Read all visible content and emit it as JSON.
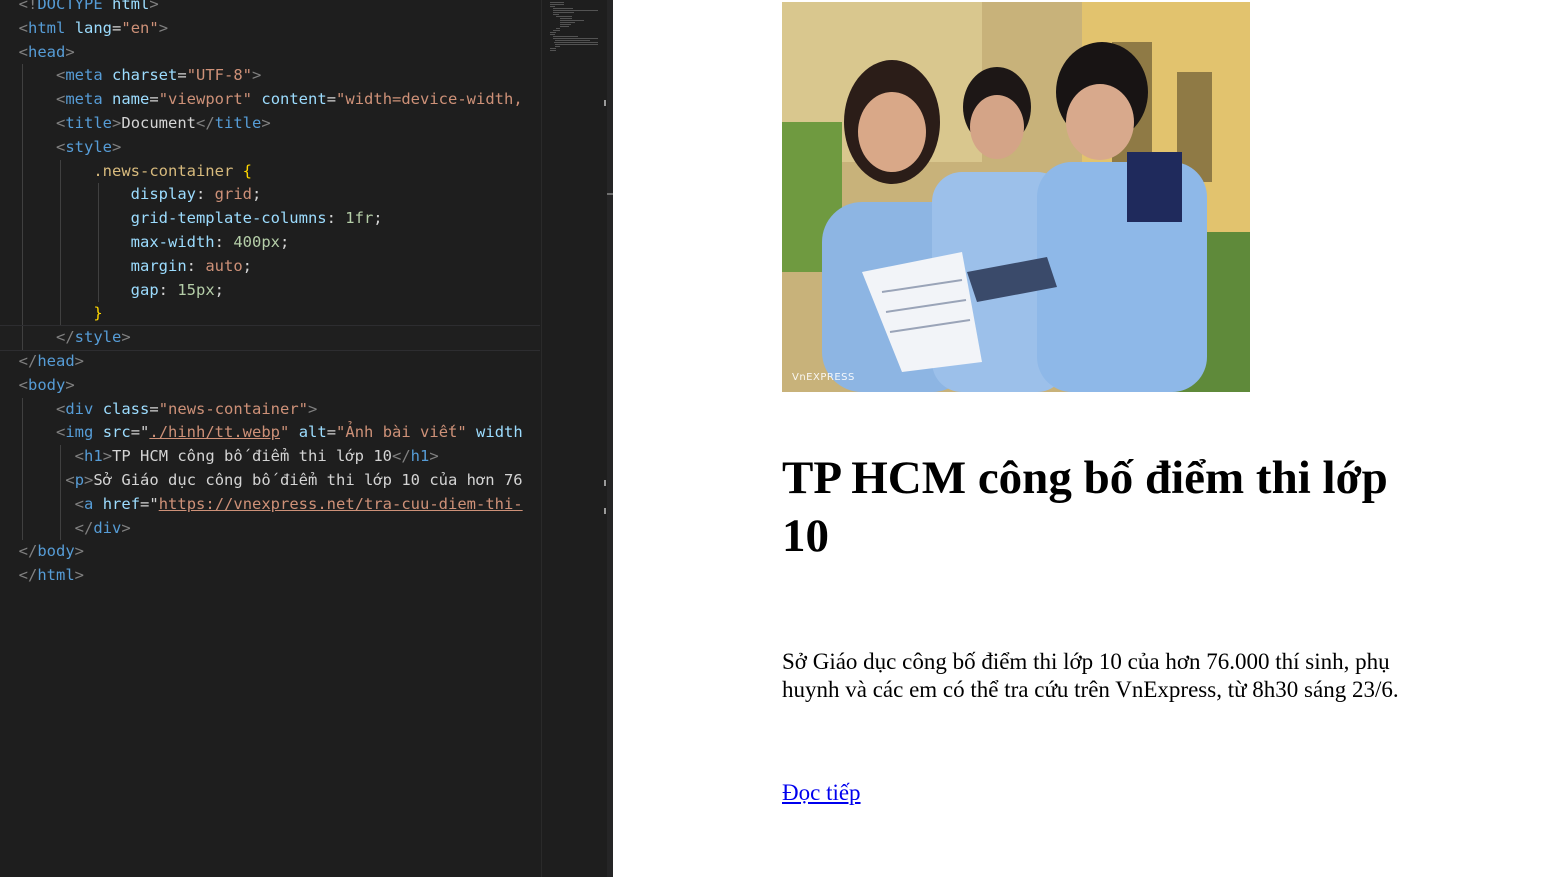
{
  "editor": {
    "code_lines": [
      [
        [
          "t",
          "<!"
        ],
        [
          "tn",
          "DOCTYPE"
        ],
        [
          "tx",
          " "
        ],
        [
          "an",
          "html"
        ],
        [
          "t",
          ">"
        ]
      ],
      [
        [
          "t",
          "<"
        ],
        [
          "tn",
          "html"
        ],
        [
          "tx",
          " "
        ],
        [
          "an",
          "lang"
        ],
        [
          "tx",
          "="
        ],
        [
          "av",
          "\"en\""
        ],
        [
          "t",
          ">"
        ]
      ],
      [
        [
          "t",
          "<"
        ],
        [
          "tn",
          "head"
        ],
        [
          "t",
          ">"
        ]
      ],
      [
        [
          "tx",
          "    "
        ],
        [
          "t",
          "<"
        ],
        [
          "tn",
          "meta"
        ],
        [
          "tx",
          " "
        ],
        [
          "an",
          "charset"
        ],
        [
          "tx",
          "="
        ],
        [
          "av",
          "\"UTF-8\""
        ],
        [
          "t",
          ">"
        ]
      ],
      [
        [
          "tx",
          "    "
        ],
        [
          "t",
          "<"
        ],
        [
          "tn",
          "meta"
        ],
        [
          "tx",
          " "
        ],
        [
          "an",
          "name"
        ],
        [
          "tx",
          "="
        ],
        [
          "av",
          "\"viewport\""
        ],
        [
          "tx",
          " "
        ],
        [
          "an",
          "content"
        ],
        [
          "tx",
          "="
        ],
        [
          "av",
          "\"width=device-width,"
        ]
      ],
      [
        [
          "tx",
          "    "
        ],
        [
          "t",
          "<"
        ],
        [
          "tn",
          "title"
        ],
        [
          "t",
          ">"
        ],
        [
          "tx",
          "Document"
        ],
        [
          "t",
          "</"
        ],
        [
          "tn",
          "title"
        ],
        [
          "t",
          ">"
        ]
      ],
      [
        [
          "tx",
          "    "
        ],
        [
          "t",
          "<"
        ],
        [
          "tn",
          "style"
        ],
        [
          "t",
          ">"
        ]
      ],
      [
        [
          "tx",
          "        "
        ],
        [
          "sel",
          ".news-container"
        ],
        [
          "tx",
          " "
        ],
        [
          "br",
          "{"
        ]
      ],
      [
        [
          "tx",
          "            "
        ],
        [
          "an",
          "display"
        ],
        [
          "tx",
          ": "
        ],
        [
          "av",
          "grid"
        ],
        [
          "tx",
          ";"
        ]
      ],
      [
        [
          "tx",
          "            "
        ],
        [
          "an",
          "grid-template-columns"
        ],
        [
          "tx",
          ": "
        ],
        [
          "nm",
          "1fr"
        ],
        [
          "tx",
          ";"
        ]
      ],
      [
        [
          "tx",
          "            "
        ],
        [
          "an",
          "max-width"
        ],
        [
          "tx",
          ": "
        ],
        [
          "nm",
          "400px"
        ],
        [
          "tx",
          ";"
        ]
      ],
      [
        [
          "tx",
          "            "
        ],
        [
          "an",
          "margin"
        ],
        [
          "tx",
          ": "
        ],
        [
          "av",
          "auto"
        ],
        [
          "tx",
          ";"
        ]
      ],
      [
        [
          "tx",
          "            "
        ],
        [
          "an",
          "gap"
        ],
        [
          "tx",
          ": "
        ],
        [
          "nm",
          "15px"
        ],
        [
          "tx",
          ";"
        ]
      ],
      [
        [
          "tx",
          "        "
        ],
        [
          "br",
          "}"
        ]
      ],
      [
        [
          "tx",
          "    "
        ],
        [
          "t",
          "</"
        ],
        [
          "tn",
          "style"
        ],
        [
          "t",
          ">"
        ]
      ],
      [
        [
          "t",
          "</"
        ],
        [
          "tn",
          "head"
        ],
        [
          "t",
          ">"
        ]
      ],
      [
        [
          "t",
          "<"
        ],
        [
          "tn",
          "body"
        ],
        [
          "t",
          ">"
        ]
      ],
      [
        [
          "tx",
          "    "
        ],
        [
          "t",
          "<"
        ],
        [
          "tn",
          "div"
        ],
        [
          "tx",
          " "
        ],
        [
          "an",
          "class"
        ],
        [
          "tx",
          "="
        ],
        [
          "av",
          "\"news-container\""
        ],
        [
          "t",
          ">"
        ]
      ],
      [
        [
          "tx",
          "    "
        ],
        [
          "t",
          "<"
        ],
        [
          "tn",
          "img"
        ],
        [
          "tx",
          " "
        ],
        [
          "an",
          "src"
        ],
        [
          "tx",
          "=\""
        ],
        [
          "url",
          "./hinh/tt.webp"
        ],
        [
          "av",
          "\""
        ],
        [
          "tx",
          " "
        ],
        [
          "an",
          "alt"
        ],
        [
          "tx",
          "="
        ],
        [
          "av",
          "\"Ảnh bài viết\""
        ],
        [
          "tx",
          " "
        ],
        [
          "an",
          "width"
        ]
      ],
      [
        [
          "tx",
          "      "
        ],
        [
          "t",
          "<"
        ],
        [
          "tn",
          "h1"
        ],
        [
          "t",
          ">"
        ],
        [
          "tx",
          "TP HCM công bố điểm thi lớp 10"
        ],
        [
          "t",
          "</"
        ],
        [
          "tn",
          "h1"
        ],
        [
          "t",
          ">"
        ]
      ],
      [
        [
          "tx",
          "     "
        ],
        [
          "t",
          "<"
        ],
        [
          "tn",
          "p"
        ],
        [
          "t",
          ">"
        ],
        [
          "tx",
          "Sở Giáo dục công bố điểm thi lớp 10 của hơn 76"
        ]
      ],
      [
        [
          "tx",
          "      "
        ],
        [
          "t",
          "<"
        ],
        [
          "tn",
          "a"
        ],
        [
          "tx",
          " "
        ],
        [
          "an",
          "href"
        ],
        [
          "tx",
          "=\""
        ],
        [
          "url",
          "https://vnexpress.net/tra-cuu-diem-thi-"
        ]
      ],
      [
        [
          "tx",
          "      "
        ],
        [
          "t",
          "</"
        ],
        [
          "tn",
          "div"
        ],
        [
          "t",
          ">"
        ]
      ],
      [
        [
          "t",
          "</"
        ],
        [
          "tn",
          "body"
        ],
        [
          "t",
          ">"
        ]
      ],
      [
        [
          "t",
          "</"
        ],
        [
          "tn",
          "html"
        ],
        [
          "t",
          ">"
        ]
      ]
    ]
  },
  "preview": {
    "image_alt": "Ảnh bài viết",
    "image_logo": "VnEXPRESS",
    "headline": "TP HCM công bố điểm thi lớp 10",
    "summary": "Sở Giáo dục công bố điểm thi lớp 10 của hơn 76.000 thí sinh, phụ huynh và các em có thể tra cứu trên VnExpress, từ 8h30 sáng 23/6.",
    "read_more": "Đọc tiếp"
  }
}
